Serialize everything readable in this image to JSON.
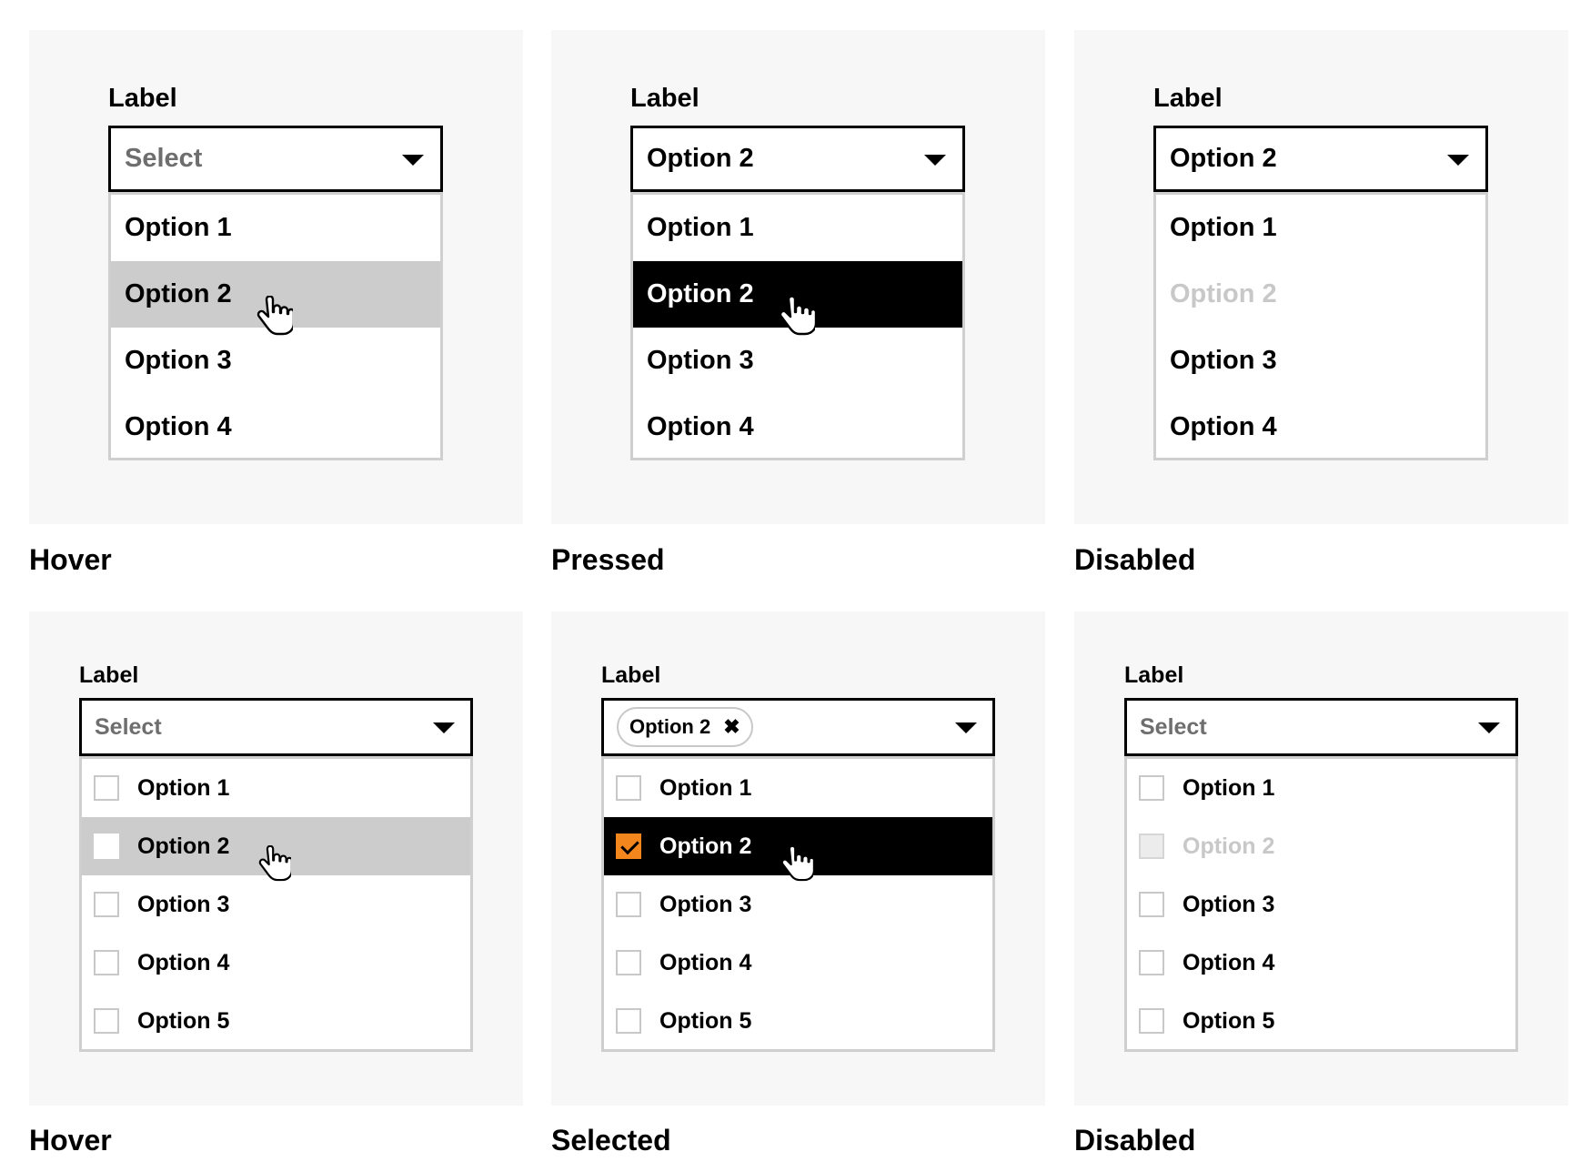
{
  "panels": {
    "p1": {
      "label": "Label",
      "value": "Select",
      "options": [
        "Option 1",
        "Option 2",
        "Option 3",
        "Option 4"
      ],
      "caption": "Hover"
    },
    "p2": {
      "label": "Label",
      "value": "Option 2",
      "options": [
        "Option 1",
        "Option 2",
        "Option 3",
        "Option 4"
      ],
      "caption": "Pressed"
    },
    "p3": {
      "label": "Label",
      "value": "Option 2",
      "options": [
        "Option 1",
        "Option 2",
        "Option 3",
        "Option 4"
      ],
      "caption": "Disabled"
    },
    "p4": {
      "label": "Label",
      "value": "Select",
      "options": [
        "Option 1",
        "Option 2",
        "Option 3",
        "Option 4",
        "Option 5"
      ],
      "caption": "Hover"
    },
    "p5": {
      "label": "Label",
      "chip": "Option 2",
      "chip_remove": "✖",
      "options": [
        "Option 1",
        "Option 2",
        "Option 3",
        "Option 4",
        "Option 5"
      ],
      "caption": "Selected"
    },
    "p6": {
      "label": "Label",
      "value": "Select",
      "options": [
        "Option 1",
        "Option 2",
        "Option 3",
        "Option 4",
        "Option 5"
      ],
      "caption": "Disabled"
    }
  },
  "icons": {
    "caret": "chevron-down-icon",
    "cursor": "hand-pointer-icon",
    "check": "checkmark-icon",
    "remove": "close-icon"
  },
  "colors": {
    "panel_bg": "#f7f7f7",
    "hover_bg": "#cccccc",
    "pressed_bg": "#000000",
    "disabled_text": "#c8c8c8",
    "accent_orange": "#f3871e"
  }
}
